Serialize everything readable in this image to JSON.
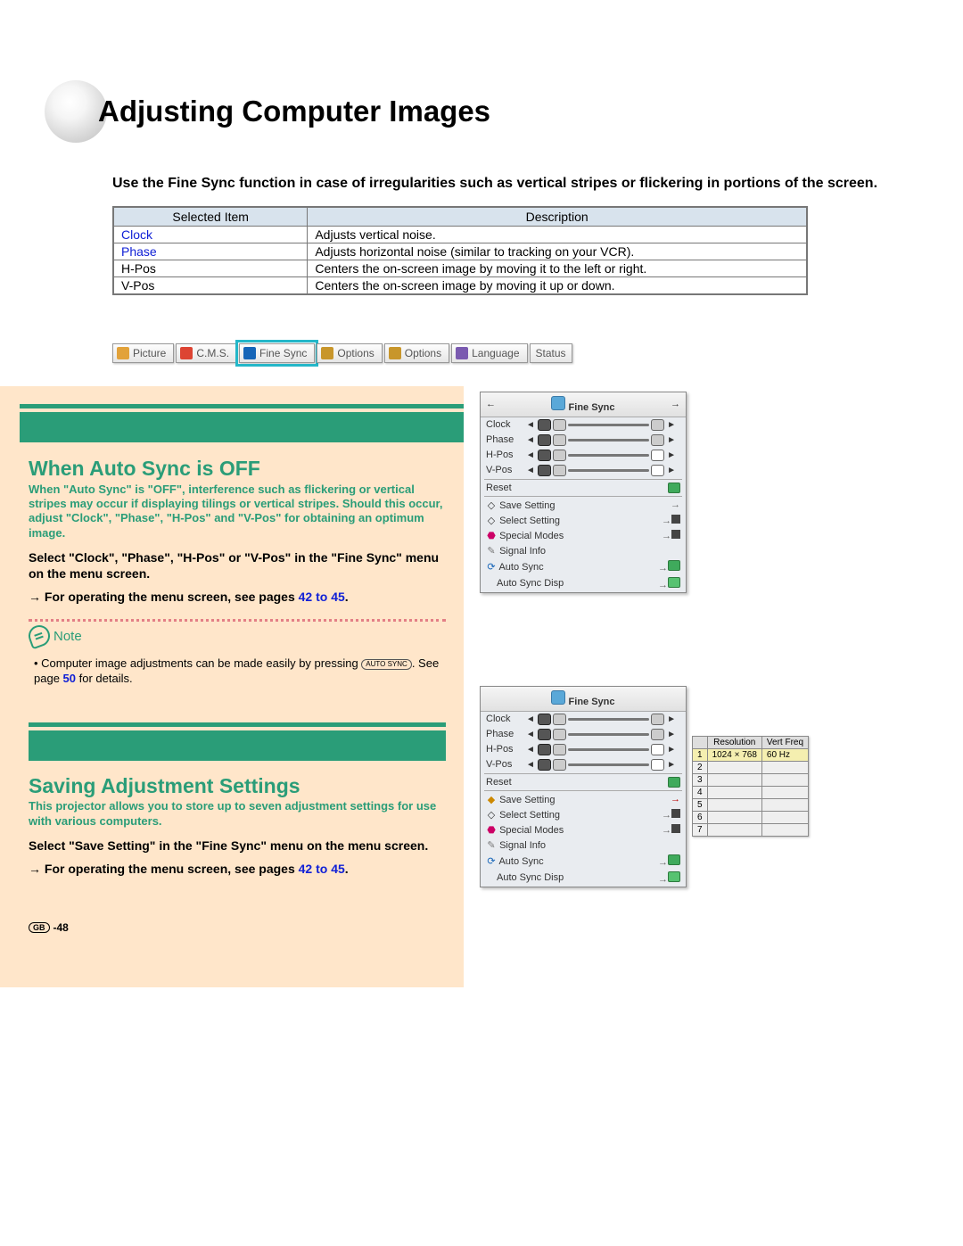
{
  "page_title": "Adjusting Computer Images",
  "intro": "Use the Fine Sync function in case of irregularities such as vertical stripes or flickering in portions of the screen.",
  "table": {
    "headers": [
      "Selected Item",
      "Description"
    ],
    "rows": [
      {
        "item": "Clock",
        "link": true,
        "desc": "Adjusts vertical noise."
      },
      {
        "item": "Phase",
        "link": true,
        "desc": "Adjusts horizontal noise (similar to tracking on your VCR)."
      },
      {
        "item": "H-Pos",
        "link": false,
        "desc": "Centers the on-screen image by moving it to the left or right."
      },
      {
        "item": "V-Pos",
        "link": false,
        "desc": "Centers the on-screen image by moving it up or down."
      }
    ]
  },
  "menubar": [
    "Picture",
    "C.M.S.",
    "Fine Sync",
    "Options",
    "Options",
    "Language",
    "Status"
  ],
  "section1": {
    "title": "When Auto Sync is OFF",
    "teal": "When \"Auto Sync\" is \"OFF\", interference such as flickering or vertical stripes may occur if displaying tilings or vertical stripes. Should this occur, adjust \"Clock\", \"Phase\", \"H-Pos\" and \"V-Pos\" for obtaining an optimum image.",
    "body1": "Select \"Clock\", \"Phase\", \"H-Pos\" or \"V-Pos\" in the \"Fine Sync\" menu  on the menu screen.",
    "body2a": "→ For operating the menu screen, see pages ",
    "body2_link": "42 to 45",
    "body2b": ".",
    "note_label": "Note",
    "note_body_a": "• Computer image adjustments can be made easily by pressing ",
    "note_icon_label": "AUTO SYNC",
    "note_body_b": ". See page ",
    "note_link": "50",
    "note_body_c": " for details."
  },
  "section2": {
    "title": "Saving Adjustment Settings",
    "teal": "This projector allows you to store up to seven adjustment settings for use with various computers.",
    "body1": "Select \"Save Setting\" in the \"Fine Sync\" menu on the menu screen.",
    "body2a": "→ For operating the menu screen, see pages ",
    "body2_link": "42 to 45",
    "body2b": "."
  },
  "osd": {
    "title": "Fine Sync",
    "sliders": [
      "Clock",
      "Phase",
      "H-Pos",
      "V-Pos"
    ],
    "reset": "Reset",
    "menu": [
      "Save Setting",
      "Select Setting",
      "Special Modes",
      "Signal Info",
      "Auto Sync",
      "Auto Sync Disp"
    ]
  },
  "res_table": {
    "headers": [
      "",
      "Resolution",
      "Vert Freq"
    ],
    "row": [
      "1",
      "1024 × 768",
      "60  Hz"
    ],
    "blank_rows": [
      "2",
      "3",
      "4",
      "5",
      "6",
      "7"
    ],
    "selected_in_section2": "Save Setting"
  },
  "footer": {
    "region": "GB",
    "page": "-48"
  }
}
